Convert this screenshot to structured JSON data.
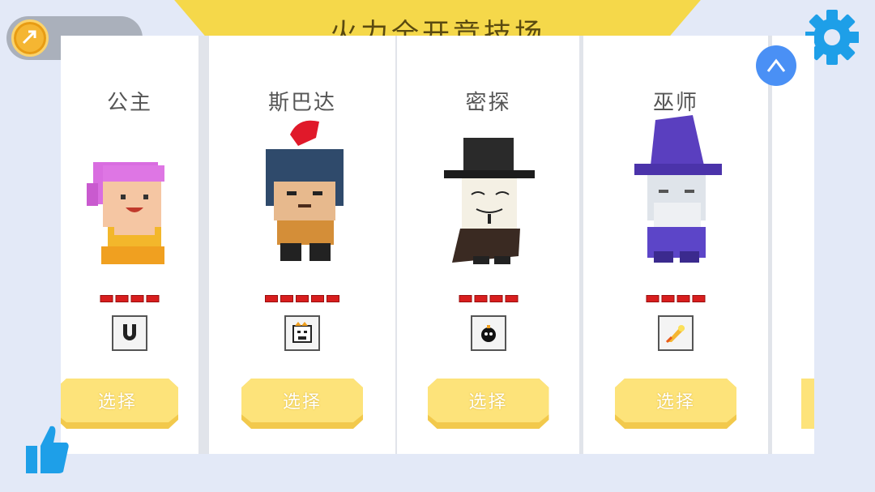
{
  "header": {
    "title": "火力全开竞技场"
  },
  "wallet": {
    "amount": ""
  },
  "characters": [
    {
      "name": "公主",
      "select_label": "选择",
      "stat_bars": 4,
      "skill_icon": "magnet-icon"
    },
    {
      "name": "斯巴达",
      "select_label": "选择",
      "stat_bars": 5,
      "skill_icon": "angry-face-icon"
    },
    {
      "name": "密探",
      "select_label": "选择",
      "stat_bars": 4,
      "skill_icon": "bomb-icon"
    },
    {
      "name": "巫师",
      "select_label": "选择",
      "stat_bars": 4,
      "skill_icon": "fireball-icon"
    }
  ],
  "colors": {
    "accent_blue": "#4a90f5",
    "button_yellow": "#fde37a",
    "stat_red": "#d81e1e",
    "banner_yellow": "#f5d84a"
  },
  "icons": {
    "settings": "gear-icon",
    "collapse": "chevron-up-icon",
    "like": "thumbs-up-icon",
    "coin": "coin-icon"
  }
}
